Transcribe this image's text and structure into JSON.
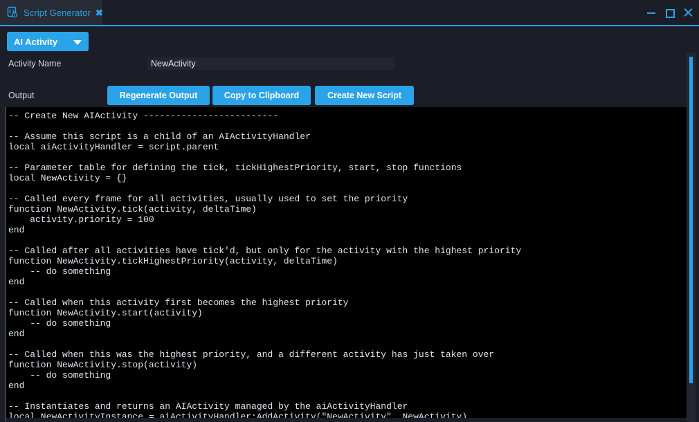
{
  "window": {
    "tab": {
      "icon": "script-generator-icon",
      "label": "Script Generator",
      "close_glyph": "✖"
    },
    "controls": {
      "minimize": "minimize-icon",
      "maximize": "maximize-icon",
      "close": "close-icon"
    },
    "accent_color": "#2aa3e8",
    "background_color": "#1b1e27",
    "code_background_color": "#000000"
  },
  "toolbar": {
    "type_dropdown": {
      "selected": "AI Activity",
      "arrow_icon": "chevron-down-icon"
    }
  },
  "form": {
    "activity_name_label": "Activity Name",
    "activity_name_value": "NewActivity",
    "activity_name_placeholder": "",
    "output_label": "Output",
    "buttons": {
      "regenerate": "Regenerate Output",
      "copy": "Copy to Clipboard",
      "create": "Create New Script"
    }
  },
  "output": {
    "code": "-- Create New AIActivity -------------------------\n\n-- Assume this script is a child of an AIActivityHandler\nlocal aiActivityHandler = script.parent\n\n-- Parameter table for defining the tick, tickHighestPriority, start, stop functions\nlocal NewActivity = {}\n\n-- Called every frame for all activities, usually used to set the priority\nfunction NewActivity.tick(activity, deltaTime)\n    activity.priority = 100\nend\n\n-- Called after all activities have tick'd, but only for the activity with the highest priority\nfunction NewActivity.tickHighestPriority(activity, deltaTime)\n    -- do something\nend\n\n-- Called when this activity first becomes the highest priority\nfunction NewActivity.start(activity)\n    -- do something\nend\n\n-- Called when this was the highest priority, and a different activity has just taken over\nfunction NewActivity.stop(activity)\n    -- do something\nend\n\n-- Instantiates and returns an AIActivity managed by the aiActivityHandler\nlocal NewActivityInstance = aiActivityHandler:AddActivity(\"NewActivity\", NewActivity)"
  },
  "scrollbar": {
    "orientation": "vertical",
    "thumb_color": "#2aa3e8"
  }
}
